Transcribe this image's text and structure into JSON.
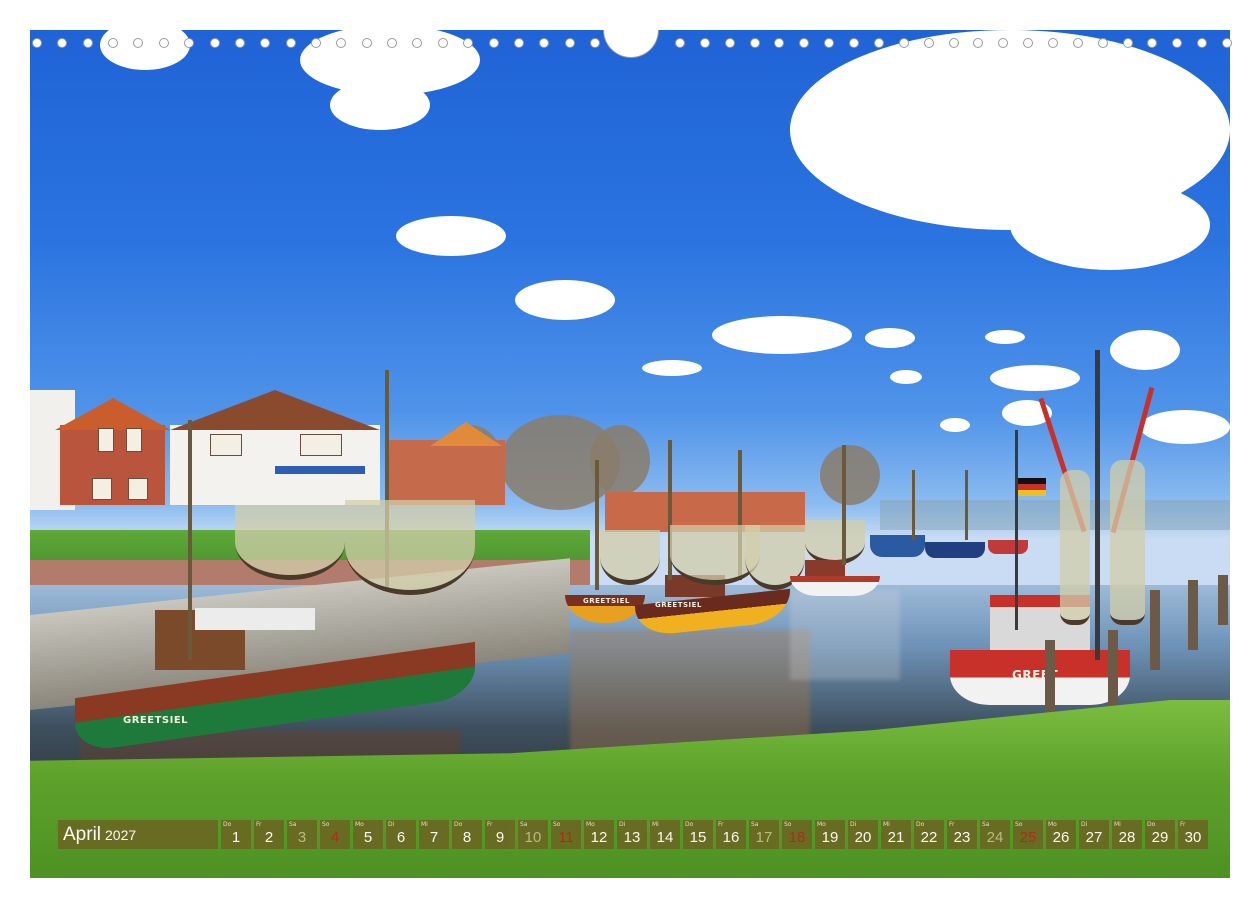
{
  "calendar": {
    "month": "April",
    "year": "2027",
    "days": [
      {
        "n": "1",
        "dow": "Do",
        "type": "weekday"
      },
      {
        "n": "2",
        "dow": "Fr",
        "type": "weekday"
      },
      {
        "n": "3",
        "dow": "Sa",
        "type": "sat"
      },
      {
        "n": "4",
        "dow": "So",
        "type": "sun"
      },
      {
        "n": "5",
        "dow": "Mo",
        "type": "weekday"
      },
      {
        "n": "6",
        "dow": "Di",
        "type": "weekday"
      },
      {
        "n": "7",
        "dow": "Mi",
        "type": "weekday"
      },
      {
        "n": "8",
        "dow": "Do",
        "type": "weekday"
      },
      {
        "n": "9",
        "dow": "Fr",
        "type": "weekday"
      },
      {
        "n": "10",
        "dow": "Sa",
        "type": "sat"
      },
      {
        "n": "11",
        "dow": "So",
        "type": "sun"
      },
      {
        "n": "12",
        "dow": "Mo",
        "type": "weekday"
      },
      {
        "n": "13",
        "dow": "Di",
        "type": "weekday"
      },
      {
        "n": "14",
        "dow": "Mi",
        "type": "weekday"
      },
      {
        "n": "15",
        "dow": "Do",
        "type": "weekday"
      },
      {
        "n": "16",
        "dow": "Fr",
        "type": "weekday"
      },
      {
        "n": "17",
        "dow": "Sa",
        "type": "sat"
      },
      {
        "n": "18",
        "dow": "So",
        "type": "sun"
      },
      {
        "n": "19",
        "dow": "Mo",
        "type": "weekday"
      },
      {
        "n": "20",
        "dow": "Di",
        "type": "weekday"
      },
      {
        "n": "21",
        "dow": "Mi",
        "type": "weekday"
      },
      {
        "n": "22",
        "dow": "Do",
        "type": "weekday"
      },
      {
        "n": "23",
        "dow": "Fr",
        "type": "weekday"
      },
      {
        "n": "24",
        "dow": "Sa",
        "type": "sat"
      },
      {
        "n": "25",
        "dow": "So",
        "type": "sun"
      },
      {
        "n": "26",
        "dow": "Mo",
        "type": "weekday"
      },
      {
        "n": "27",
        "dow": "Di",
        "type": "weekday"
      },
      {
        "n": "28",
        "dow": "Mi",
        "type": "weekday"
      },
      {
        "n": "29",
        "dow": "Do",
        "type": "weekday"
      },
      {
        "n": "30",
        "dow": "Fr",
        "type": "weekday"
      }
    ]
  },
  "photo": {
    "boat_labels": [
      "GREETSIEL",
      "GREETSIEL",
      "GREETSIEL",
      "GREET"
    ]
  },
  "binding": {
    "ring_count": 46
  },
  "colors": {
    "strip": "#6a6a22",
    "sunday": "#b5261e",
    "sky": "#2b74e0",
    "grass": "#5ea22c"
  }
}
